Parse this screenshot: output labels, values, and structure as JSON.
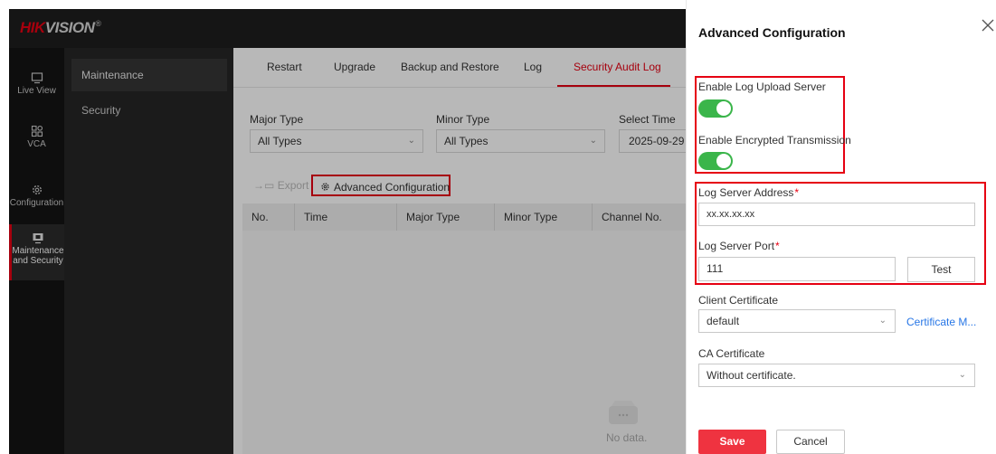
{
  "header": {
    "logo_primary": "HIK",
    "logo_secondary": "VISION",
    "logo_mark": "®"
  },
  "nav": {
    "items": [
      {
        "label": "Live View",
        "icon": "monitor-icon"
      },
      {
        "label": "VCA",
        "icon": "vca-grid-icon"
      },
      {
        "label": "Configuration",
        "icon": "gear-icon"
      },
      {
        "label_line1": "Maintenance",
        "label_line2": "and Security",
        "icon": "maintenance-icon",
        "active": true
      }
    ]
  },
  "submenu": {
    "items": [
      {
        "label": "Maintenance",
        "active": true
      },
      {
        "label": "Security"
      }
    ]
  },
  "tabs": [
    "Restart",
    "Upgrade",
    "Backup and Restore",
    "Log",
    "Security Audit Log"
  ],
  "active_tab": "Security Audit Log",
  "filters": {
    "major_type": {
      "label": "Major Type",
      "value": "All Types"
    },
    "minor_type": {
      "label": "Minor Type",
      "value": "All Types"
    },
    "select_time": {
      "label": "Select Time",
      "value": "2025-09-29"
    }
  },
  "toolbar": {
    "export_label": "Export",
    "advanced_label": "Advanced Configuration"
  },
  "table": {
    "columns": [
      "No.",
      "Time",
      "Major Type",
      "Minor Type",
      "Channel No."
    ],
    "empty_text": "No data."
  },
  "panel": {
    "title": "Advanced Configuration",
    "enable_log_upload": {
      "label": "Enable Log Upload Server",
      "on": true
    },
    "enable_encrypted": {
      "label": "Enable Encrypted Transmission",
      "on": true
    },
    "server_address": {
      "label": "Log Server Address",
      "required": "*",
      "value": "xx.xx.xx.xx"
    },
    "server_port": {
      "label": "Log Server Port",
      "required": "*",
      "value": "111"
    },
    "test_label": "Test",
    "client_cert": {
      "label": "Client Certificate",
      "value": "default",
      "link": "Certificate M..."
    },
    "ca_cert": {
      "label": "CA Certificate",
      "value": "Without certificate."
    },
    "save_label": "Save",
    "cancel_label": "Cancel"
  },
  "colors": {
    "accent": "#e60012",
    "toggle_on": "#3ab54a",
    "link": "#2776e6",
    "save_bg": "#ef3340"
  }
}
